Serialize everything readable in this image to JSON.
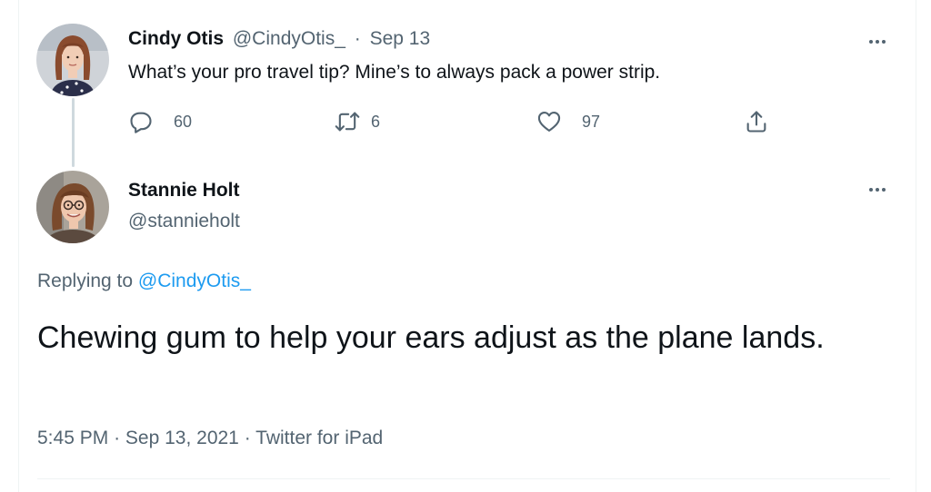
{
  "parent_tweet": {
    "display_name": "Cindy Otis",
    "handle": "@CindyOtis_",
    "separator": "·",
    "date": "Sep 13",
    "text": "What’s your pro travel tip? Mine’s to always pack a power strip.",
    "replies_count": "60",
    "retweets_count": "6",
    "likes_count": "97",
    "icons": [
      "reply-icon",
      "retweet-icon",
      "like-icon",
      "share-icon",
      "more-icon"
    ]
  },
  "reply_tweet": {
    "display_name": "Stannie Holt",
    "handle": "@stannieholt",
    "replying_prefix": "Replying to",
    "replying_to": "@CindyOtis_",
    "text": "Chewing gum to help your ears adjust as the plane lands.",
    "time": "5:45 PM",
    "date": "Sep 13, 2021",
    "source": "Twitter for iPad",
    "separator": "·"
  },
  "colors": {
    "text": "#0f1419",
    "muted": "#536471",
    "link": "#1d9bf0",
    "thread_line": "#cfd9de",
    "divider": "#eff3f4"
  }
}
